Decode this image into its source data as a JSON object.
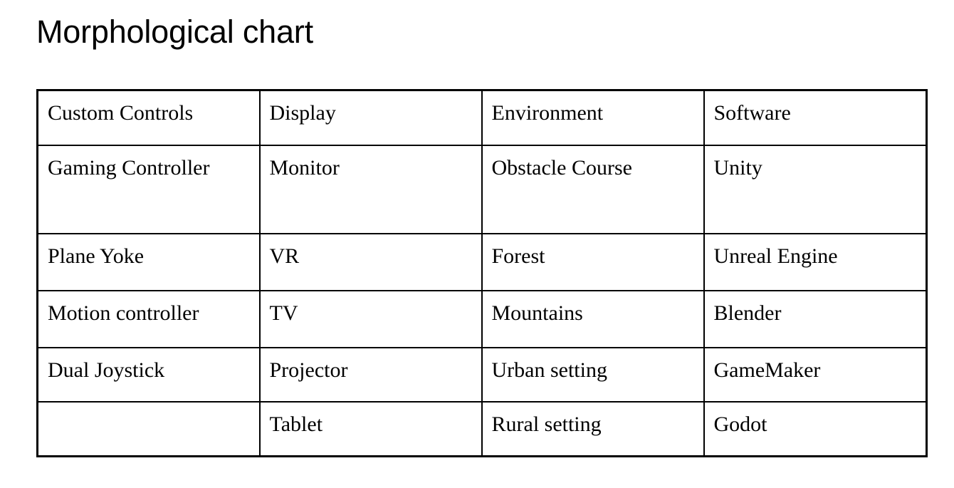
{
  "document": {
    "title": "Morphological chart"
  },
  "chart_data": {
    "type": "table",
    "title": "Morphological chart",
    "columns": [
      "Custom Controls",
      "Display",
      "Environment",
      "Software"
    ],
    "rows": [
      [
        "Gaming Controller",
        "Monitor",
        "Obstacle Course",
        "Unity"
      ],
      [
        "Plane Yoke",
        "VR",
        "Forest",
        "Unreal Engine"
      ],
      [
        "Motion controller",
        "TV",
        "Mountains",
        "Blender"
      ],
      [
        "Dual Joystick",
        "Projector",
        "Urban setting",
        "GameMaker"
      ],
      [
        "",
        "Tablet",
        "Rural setting",
        "Godot"
      ]
    ],
    "colors": {
      "background": "#ffffff",
      "text": "#000000",
      "border": "#000000"
    }
  }
}
